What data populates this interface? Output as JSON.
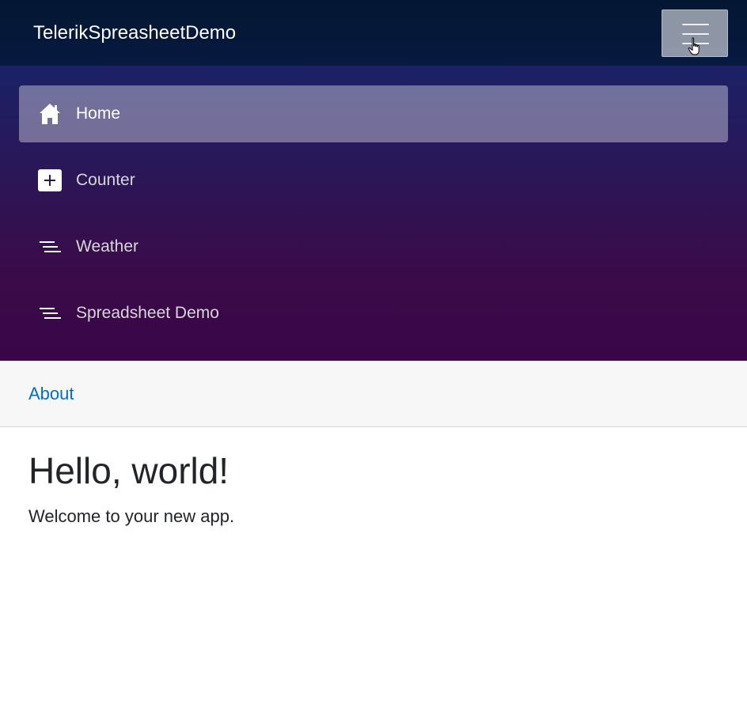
{
  "header": {
    "brand": "TelerikSpreasheetDemo",
    "toggler_icon": "hamburger-icon"
  },
  "nav": {
    "items": [
      {
        "label": "Home",
        "icon": "home-icon",
        "active": true
      },
      {
        "label": "Counter",
        "icon": "plus-square-icon",
        "active": false
      },
      {
        "label": "Weather",
        "icon": "list-icon",
        "active": false
      },
      {
        "label": "Spreadsheet Demo",
        "icon": "list-icon",
        "active": false
      }
    ]
  },
  "top_row": {
    "about_label": "About"
  },
  "main": {
    "title": "Hello, world!",
    "text": "Welcome to your new app."
  },
  "colors": {
    "header_bg": "#07193f",
    "sidebar_gradient_top": "#1b2166",
    "sidebar_gradient_bottom": "#3a0647",
    "link": "#0071c1",
    "text": "#212529"
  }
}
